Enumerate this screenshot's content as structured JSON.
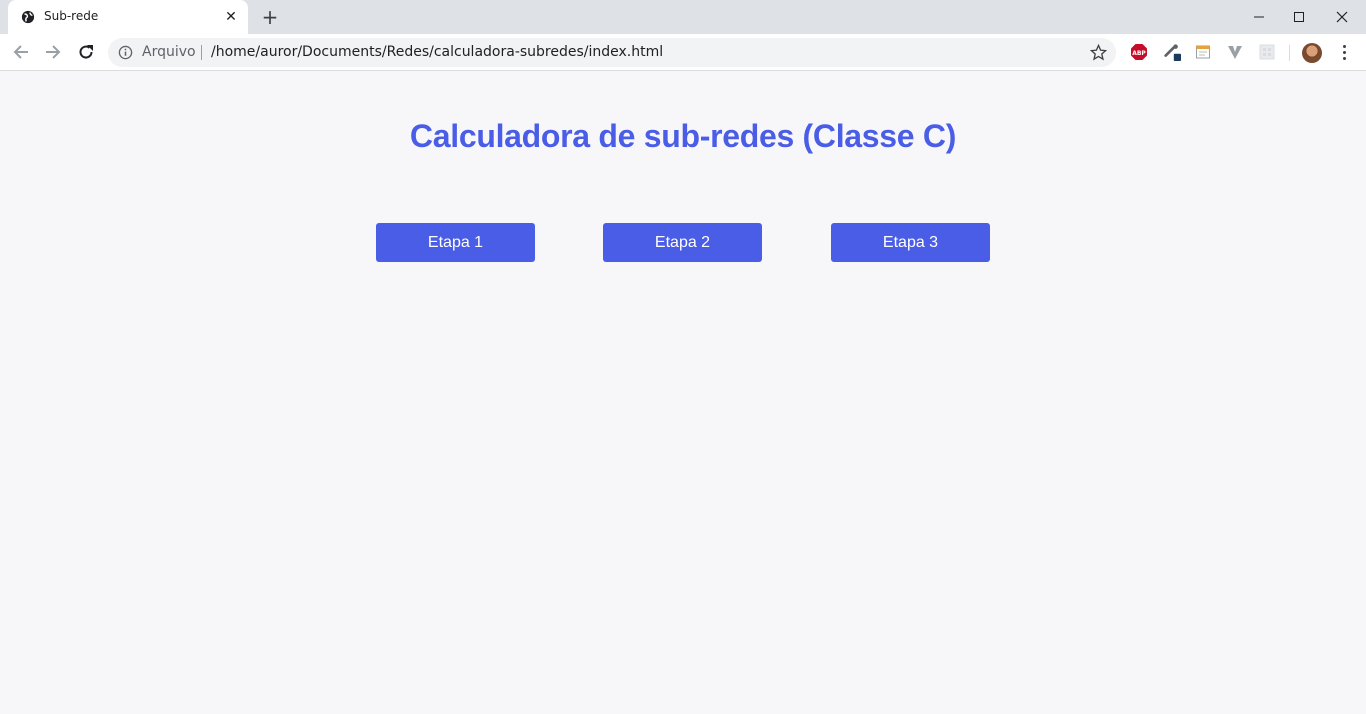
{
  "browser": {
    "tab": {
      "title": "Sub-rede",
      "close_glyph": "✕",
      "favicon": "globe-icon"
    },
    "new_tab_glyph": "+",
    "omnibox": {
      "origin_label": "Arquivo",
      "url": "/home/auror/Documents/Redes/calculadora-subredes/index.html"
    },
    "extensions": [
      "adblock-plus-icon",
      "eyedropper-icon",
      "notes-icon",
      "vivaldi-v-icon",
      "grid-extension-icon"
    ]
  },
  "page": {
    "title": "Calculadora de sub-redes (Classe C)",
    "steps": [
      {
        "label": "Etapa 1"
      },
      {
        "label": "Etapa 2"
      },
      {
        "label": "Etapa 3"
      }
    ]
  },
  "colors": {
    "accent": "#4a5de6",
    "page_background": "#f7f7f9",
    "tabstrip": "#dee1e6"
  }
}
